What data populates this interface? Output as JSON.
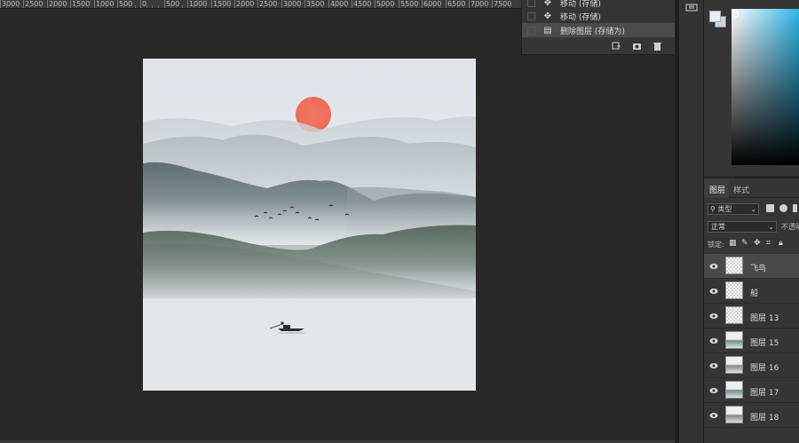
{
  "ruler": {
    "labels": [
      "3000",
      "2500",
      "2000",
      "1500",
      "1000",
      "500",
      "0",
      "500",
      "1000",
      "1500",
      "2000",
      "2500",
      "3000",
      "3500",
      "4000",
      "4500",
      "5000",
      "5500",
      "6000",
      "6500",
      "7000",
      "7500"
    ]
  },
  "history": {
    "items": [
      {
        "label": "移动 (存储)",
        "icon": "move-icon"
      },
      {
        "label": "移动 (存储)",
        "icon": "move-icon"
      },
      {
        "label": "删除图层 (存储为)",
        "icon": "document-icon",
        "active": true
      }
    ]
  },
  "layers_panel": {
    "tabs": [
      "图层",
      "样式"
    ],
    "filter_label": "类型",
    "blend_mode": "正常",
    "opacity_label": "不透明",
    "lock_label": "锁定:",
    "layers": [
      {
        "name": "飞鸟",
        "thumb": "transparent",
        "selected": true
      },
      {
        "name": "船",
        "thumb": "transparent"
      },
      {
        "name": "图层 13",
        "thumb": "transparent"
      },
      {
        "name": "图层 15",
        "thumb": "mountain"
      },
      {
        "name": "图层 16",
        "thumb": "mountain"
      },
      {
        "name": "图层 17",
        "thumb": "mountain"
      },
      {
        "name": "图层 18",
        "thumb": "mountain"
      }
    ]
  },
  "colors": {
    "foreground": "#e8eef3",
    "background": "#c9d7df",
    "picker_hue": "#2fb7e8",
    "sun": "#ef6d5a"
  }
}
